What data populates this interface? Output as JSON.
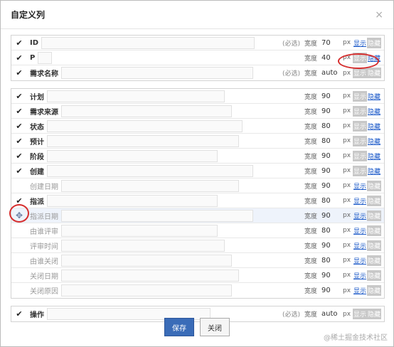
{
  "dialog": {
    "title": "自定义列",
    "close_glyph": "×",
    "save_label": "保存",
    "close_label": "关闭",
    "watermark": "@稀土掘金技术社区"
  },
  "labels": {
    "required": "(必选)",
    "width": "宽度",
    "px": "px",
    "show": "显示",
    "hide": "隐藏",
    "check": "✔",
    "move": "✥"
  },
  "groups": [
    {
      "rows": [
        {
          "name": "ID",
          "enabled": true,
          "required": true,
          "width": "70",
          "state": "hidden"
        },
        {
          "name": "P",
          "enabled": true,
          "required": false,
          "width": "40",
          "state": "visible"
        },
        {
          "name": "需求名称",
          "enabled": true,
          "required": true,
          "width": "auto",
          "state": "none"
        }
      ]
    },
    {
      "rows": [
        {
          "name": "计划",
          "enabled": true,
          "required": false,
          "width": "90",
          "state": "visible"
        },
        {
          "name": "需求来源",
          "enabled": true,
          "required": false,
          "width": "90",
          "state": "visible"
        },
        {
          "name": "状态",
          "enabled": true,
          "required": false,
          "width": "80",
          "state": "visible"
        },
        {
          "name": "预计",
          "enabled": true,
          "required": false,
          "width": "80",
          "state": "visible"
        },
        {
          "name": "阶段",
          "enabled": true,
          "required": false,
          "width": "90",
          "state": "visible"
        },
        {
          "name": "创建",
          "enabled": true,
          "required": false,
          "width": "90",
          "state": "visible"
        },
        {
          "name": "创建日期",
          "enabled": false,
          "required": false,
          "width": "90",
          "state": "hidden"
        },
        {
          "name": "指派",
          "enabled": true,
          "required": false,
          "width": "80",
          "state": "hidden"
        },
        {
          "name": "指派日期",
          "enabled": false,
          "required": false,
          "width": "90",
          "state": "hidden",
          "highlight": true
        },
        {
          "name": "由谁评审",
          "enabled": false,
          "required": false,
          "width": "80",
          "state": "hidden"
        },
        {
          "name": "评审时间",
          "enabled": false,
          "required": false,
          "width": "90",
          "state": "hidden"
        },
        {
          "name": "由谁关闭",
          "enabled": false,
          "required": false,
          "width": "80",
          "state": "hidden"
        },
        {
          "name": "关闭日期",
          "enabled": false,
          "required": false,
          "width": "90",
          "state": "hidden"
        },
        {
          "name": "关闭原因",
          "enabled": false,
          "required": false,
          "width": "90",
          "state": "hidden"
        }
      ]
    },
    {
      "rows": [
        {
          "name": "操作",
          "enabled": true,
          "required": true,
          "width": "auto",
          "state": "none"
        }
      ]
    }
  ]
}
